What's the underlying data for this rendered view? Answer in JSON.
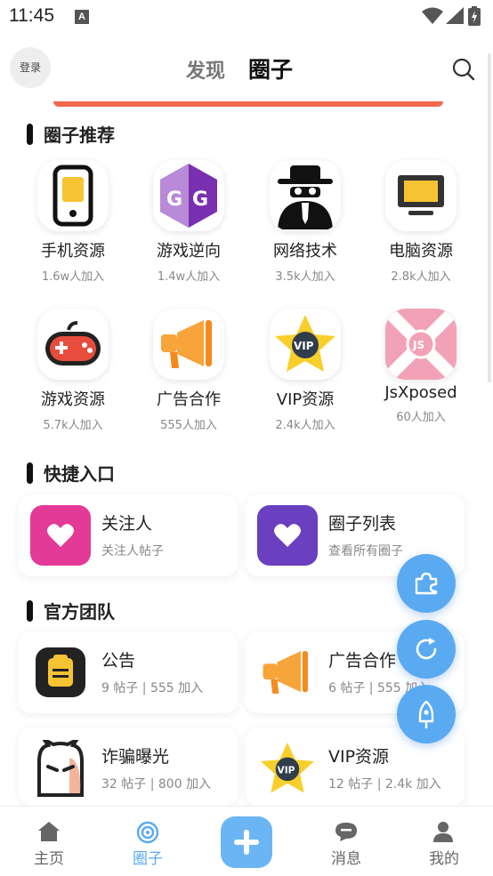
{
  "status_bar": {
    "time": "11:45",
    "notification_letter": "A"
  },
  "header": {
    "login_label": "登录",
    "tabs": [
      {
        "label": "发现",
        "active": false
      },
      {
        "label": "圈子",
        "active": true
      }
    ]
  },
  "recommend": {
    "title": "圈子推荐",
    "items": [
      {
        "name": "手机资源",
        "count": "1.6w人加入",
        "icon": "phone-icon"
      },
      {
        "name": "游戏逆向",
        "count": "1.4w人加入",
        "icon": "game-guardian-icon"
      },
      {
        "name": "网络技术",
        "count": "3.5k人加入",
        "icon": "hacker-icon"
      },
      {
        "name": "电脑资源",
        "count": "2.8k人加入",
        "icon": "monitor-icon"
      },
      {
        "name": "游戏资源",
        "count": "5.7k人加入",
        "icon": "gamepad-icon"
      },
      {
        "name": "广告合作",
        "count": "555人加入",
        "icon": "megaphone-icon"
      },
      {
        "name": "VIP资源",
        "count": "2.4k人加入",
        "icon": "vip-star-icon"
      },
      {
        "name": "JsXposed",
        "count": "60人加入",
        "icon": "jsxposed-icon"
      }
    ]
  },
  "shortcuts": {
    "title": "快捷入口",
    "items": [
      {
        "title": "关注人",
        "sub": "关注人帖子",
        "color": "#e23a96"
      },
      {
        "title": "圈子列表",
        "sub": "查看所有圈子",
        "color": "#6a3fc0"
      }
    ]
  },
  "official": {
    "title": "官方团队",
    "items": [
      {
        "title": "公告",
        "sub": "9 帖子 | 555 加入",
        "icon": "notice-icon"
      },
      {
        "title": "广告合作",
        "sub": "6 帖子 | 555 加入",
        "icon": "megaphone-icon"
      },
      {
        "title": "诈骗曝光",
        "sub": "32 帖子 | 800 加入",
        "icon": "ghost-icon"
      },
      {
        "title": "VIP资源",
        "sub": "12 帖子 | 2.4k 加入",
        "icon": "vip-star-icon"
      }
    ]
  },
  "bottom_nav": [
    {
      "label": "主页",
      "icon": "home-icon",
      "active": false
    },
    {
      "label": "圈子",
      "icon": "circle-icon",
      "active": true
    },
    {
      "label": "消息",
      "icon": "message-icon",
      "active": false
    },
    {
      "label": "我的",
      "icon": "user-icon",
      "active": false
    }
  ],
  "colors": {
    "accent": "#5aaaf2",
    "banner": "#f2694e"
  }
}
